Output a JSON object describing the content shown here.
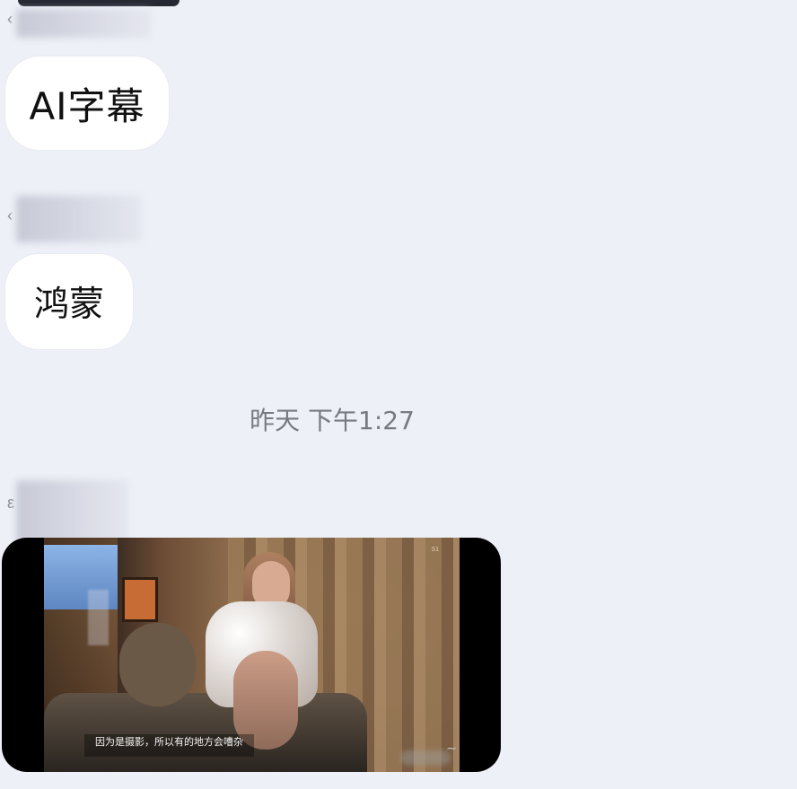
{
  "chat": {
    "messages": [
      {
        "type": "text",
        "text": "AI字幕"
      },
      {
        "type": "text",
        "text": "鸿蒙"
      }
    ],
    "timestamp": "昨天 下午1:27",
    "video": {
      "subtitle": "因为是摄影，所以有的地方会嘈杂",
      "watermark": "S1"
    }
  },
  "icons": {
    "sender_mark_1": "‹",
    "sender_mark_2": "‹",
    "sender_mark_3": "ε",
    "video_corner": "⁓"
  }
}
